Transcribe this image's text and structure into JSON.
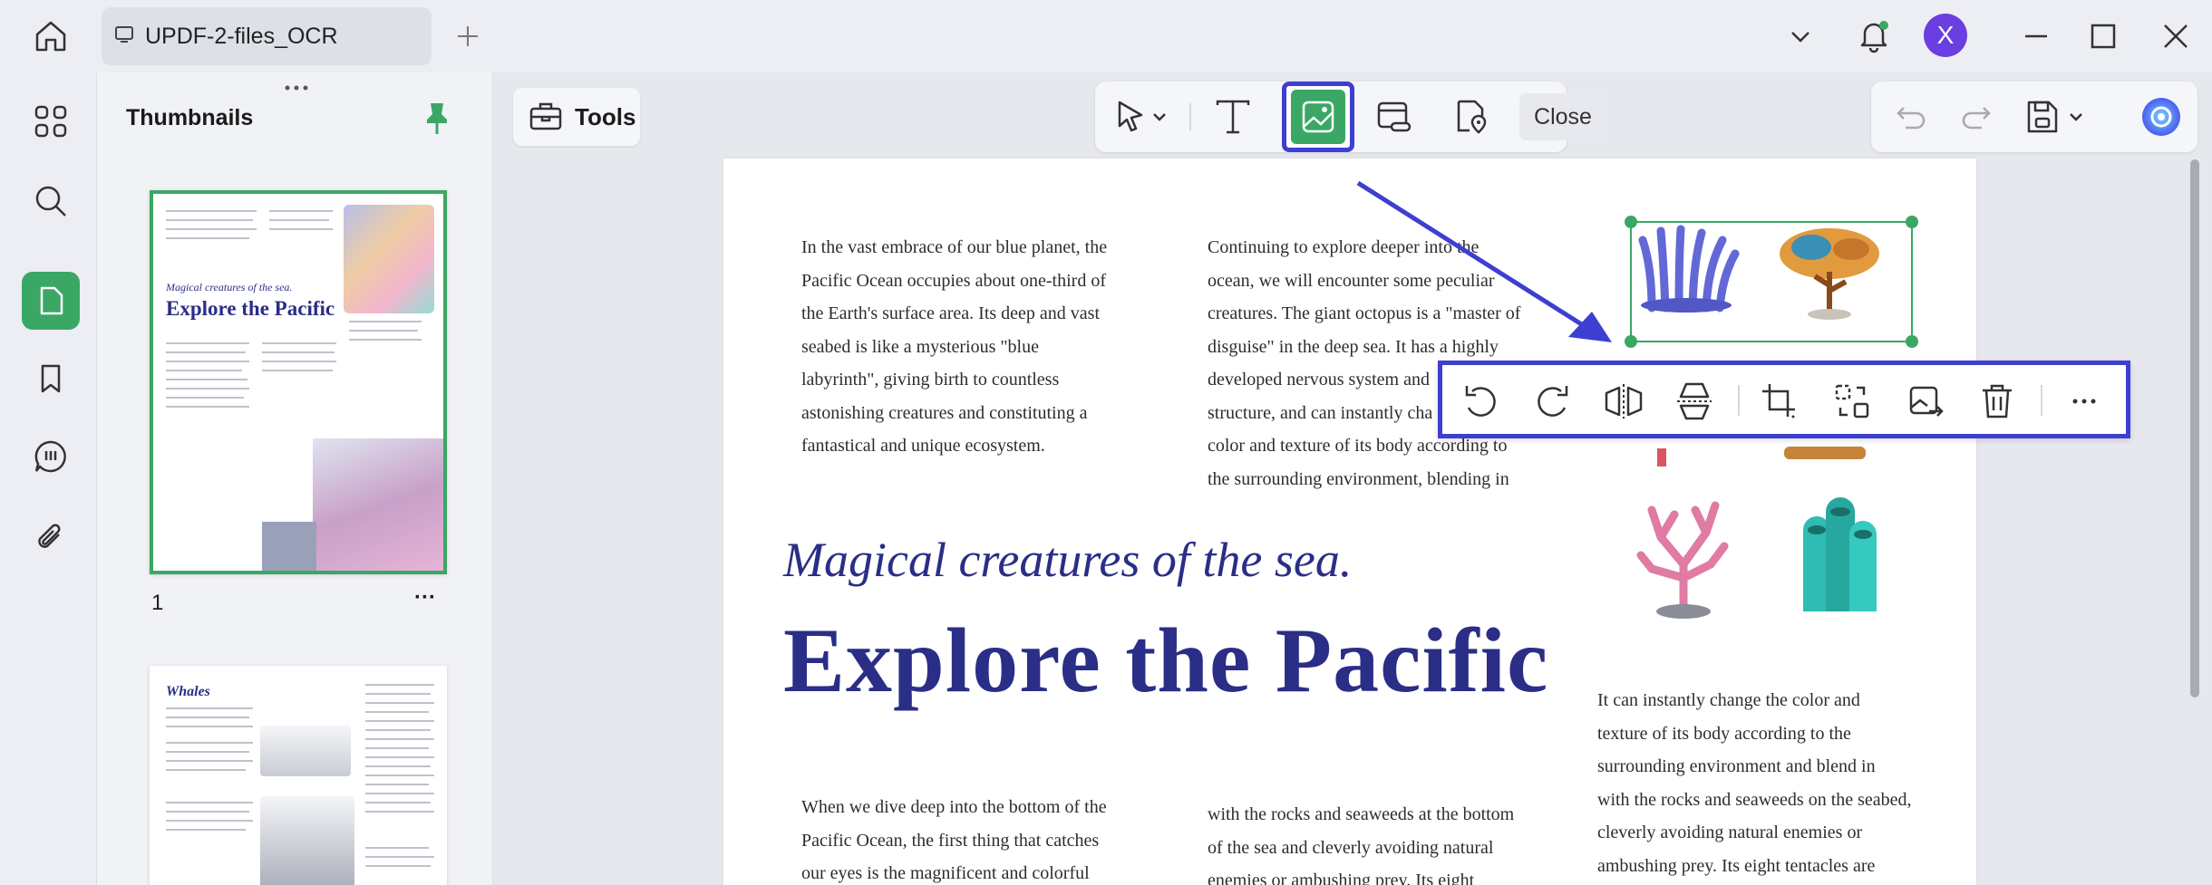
{
  "tab": {
    "title": "UPDF-2-files_OCR"
  },
  "user": {
    "initial": "X"
  },
  "thumbnails": {
    "title": "Thumbnails",
    "pages": [
      {
        "number": "1",
        "more": "···"
      }
    ]
  },
  "thumbnail2": {
    "heading": "Whales"
  },
  "tools": {
    "label": "Tools"
  },
  "edit_toolbar": {
    "close_label": "Close"
  },
  "document": {
    "col1": [
      "In the vast embrace of our blue planet, the",
      "Pacific Ocean occupies about one-third of",
      "the Earth's surface area. Its deep and vast",
      "seabed is like a mysterious \"blue",
      "labyrinth\", giving birth to countless",
      "astonishing creatures and constituting a",
      "fantastical and unique ecosystem."
    ],
    "col2": [
      "Continuing to explore deeper into the",
      "ocean, we will encounter some peculiar",
      "creatures. The giant octopus is a \"master of",
      "disguise\" in the deep sea. It has a highly",
      "developed nervous system and",
      "structure, and can instantly cha",
      "color and texture of its body according to",
      "the surrounding environment, blending in"
    ],
    "subtitle": "Magical creatures of the sea.",
    "title": "Explore the Pacific",
    "col3": [
      "It can instantly change the color and",
      "texture of its body according to the",
      "surrounding environment and blend in",
      "with the rocks and seaweeds on the seabed,",
      "cleverly avoiding natural enemies or",
      "ambushing prey. Its eight tentacles are"
    ],
    "col1b": [
      "When we dive deep into the bottom of the",
      "Pacific Ocean, the first thing that catches",
      "our eyes is the magnificent and colorful"
    ],
    "col2b": [
      "with the rocks and seaweeds at the bottom",
      "of the sea and cleverly avoiding natural",
      "enemies or ambushing prey. Its eight"
    ]
  },
  "colors": {
    "accent": "#3aa765",
    "highlight": "#3c3fd0",
    "title": "#2a2e86"
  }
}
